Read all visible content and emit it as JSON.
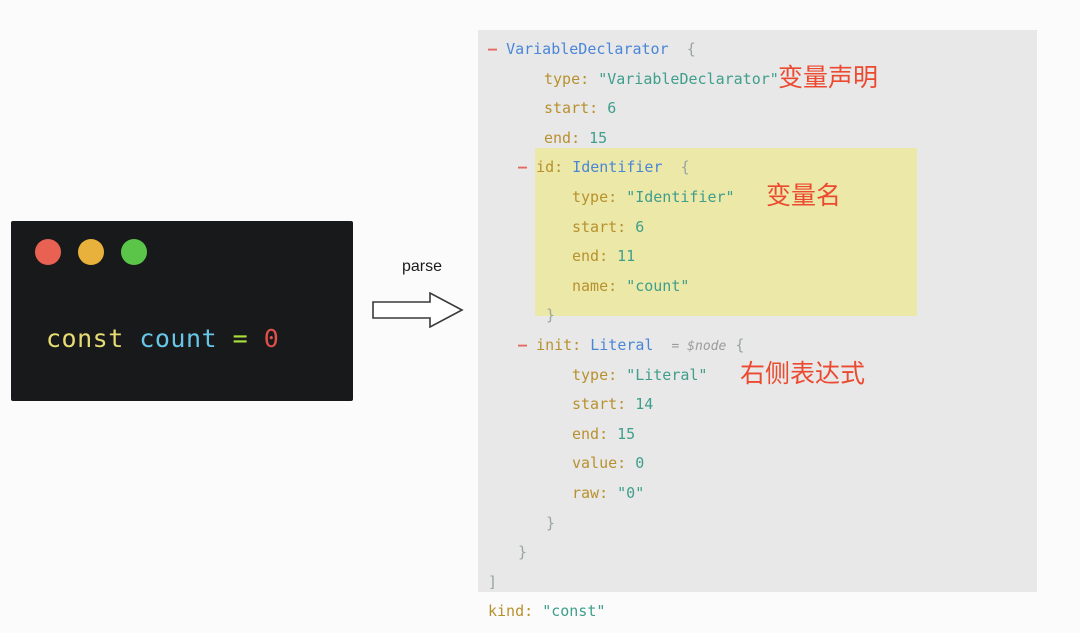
{
  "code_window": {
    "controls": [
      {
        "name": "close",
        "color": "#e96153"
      },
      {
        "name": "minimize",
        "color": "#e8b13c"
      },
      {
        "name": "maximize",
        "color": "#5bc54a"
      }
    ],
    "code": {
      "keyword": "const",
      "identifier": "count",
      "operator": "=",
      "number": "0",
      "full_text": "const count = 0"
    }
  },
  "parse": {
    "label": "parse",
    "arrow_icon": "right-block-arrow-icon"
  },
  "ast": {
    "lines": [
      {
        "id": "l1",
        "indent": 0,
        "dash": "–",
        "node": "VariableDeclarator",
        "punct": "{"
      },
      {
        "id": "l2",
        "indent": 1,
        "key": "type:",
        "value": "\"VariableDeclarator\"",
        "note": "变量声明"
      },
      {
        "id": "l3",
        "indent": 1,
        "key": "start:",
        "value": "6"
      },
      {
        "id": "l4",
        "indent": 1,
        "key": "end:",
        "value": "15"
      },
      {
        "id": "l5",
        "indent": 1,
        "dash": "–",
        "key": "id:",
        "node": "Identifier",
        "punct": "{",
        "highlight": true
      },
      {
        "id": "l6",
        "indent": 2,
        "key": "type:",
        "value": "\"Identifier\"",
        "note": "变量名",
        "highlight": true
      },
      {
        "id": "l7",
        "indent": 2,
        "key": "start:",
        "value": "6",
        "highlight": true
      },
      {
        "id": "l8",
        "indent": 2,
        "key": "end:",
        "value": "11",
        "highlight": true
      },
      {
        "id": "l9",
        "indent": 2,
        "key": "name:",
        "value": "\"count\"",
        "highlight": true
      },
      {
        "id": "l10",
        "indent": 2,
        "punct": "}",
        "highlight": true
      },
      {
        "id": "l11",
        "indent": 1,
        "dash": "–",
        "key": "init:",
        "node": "Literal",
        "meta": "= $node",
        "punct": "{"
      },
      {
        "id": "l12",
        "indent": 2,
        "key": "type:",
        "value": "\"Literal\"",
        "note": "右侧表达式"
      },
      {
        "id": "l13",
        "indent": 2,
        "key": "start:",
        "value": "14"
      },
      {
        "id": "l14",
        "indent": 2,
        "key": "end:",
        "value": "15"
      },
      {
        "id": "l15",
        "indent": 2,
        "key": "value:",
        "value": "0"
      },
      {
        "id": "l16",
        "indent": 2,
        "key": "raw:",
        "value": "\"0\""
      },
      {
        "id": "l17",
        "indent": 2,
        "punct": "}"
      },
      {
        "id": "l18",
        "indent": 1,
        "punct": "}"
      },
      {
        "id": "l19",
        "indent": 0,
        "punct": "]"
      },
      {
        "id": "l20",
        "indent": 0,
        "key": "kind:",
        "value": "\"const\""
      }
    ],
    "annotations": [
      {
        "text": "变量声明",
        "target": "VariableDeclarator type"
      },
      {
        "text": "变量名",
        "target": "Identifier type"
      },
      {
        "text": "右侧表达式",
        "target": "Literal type"
      }
    ]
  },
  "colors": {
    "page_background": "#fbfbfb",
    "code_background": "#18191a",
    "ast_background": "#e8e8e8",
    "highlight": "#ece8a7",
    "annotation_red": "#eb4a30",
    "key_gold": "#b8912f",
    "node_blue": "#4a86d8",
    "string_teal": "#3f9e8c",
    "dash_red": "#e4695e"
  }
}
